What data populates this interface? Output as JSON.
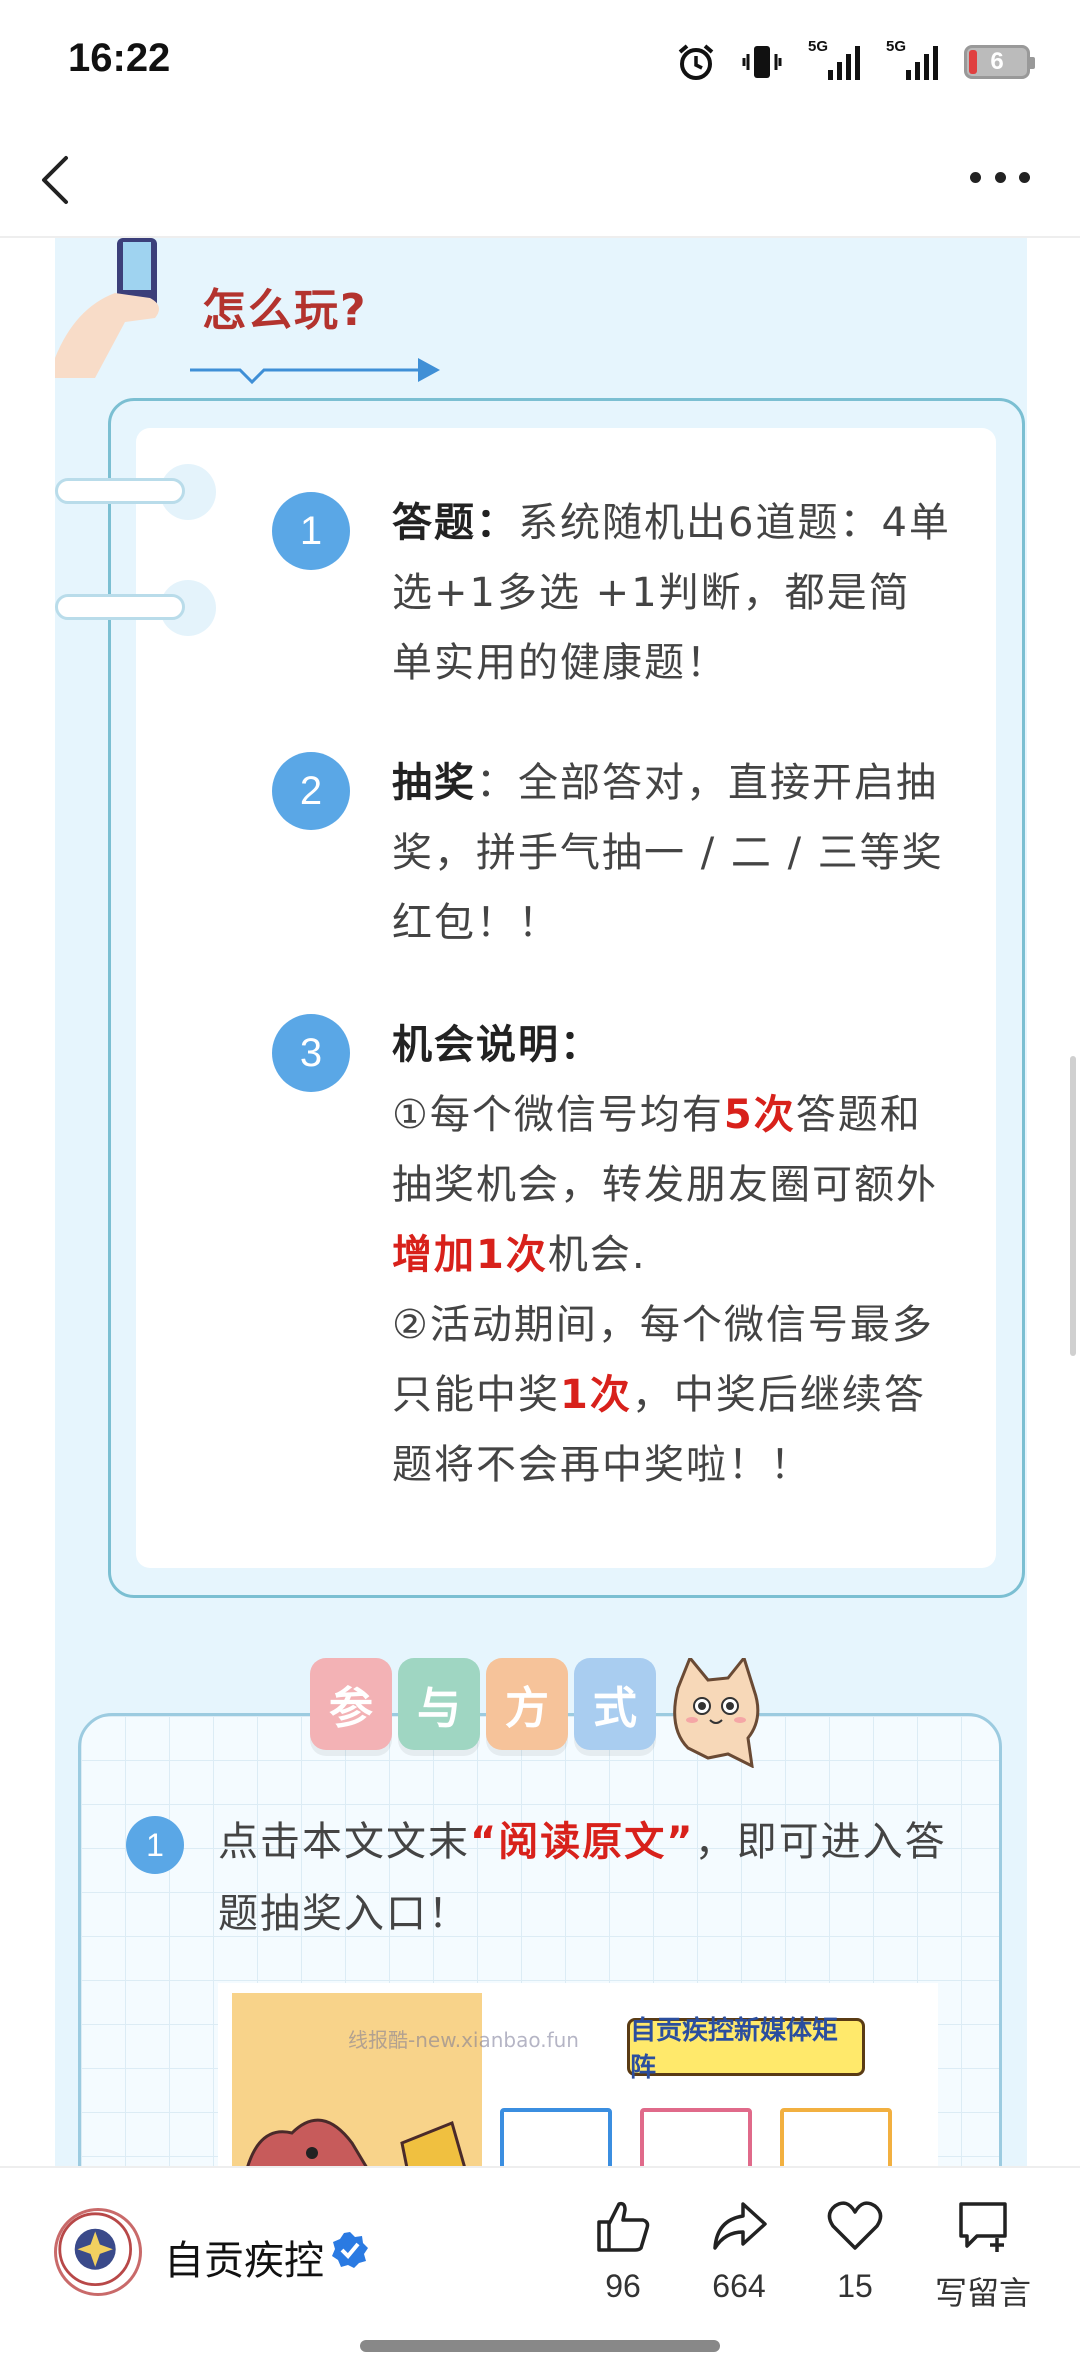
{
  "status_bar": {
    "time": "16:22",
    "network_1": "5G",
    "network_2": "5G",
    "battery": "6"
  },
  "article": {
    "how_title": "怎么玩?",
    "steps": [
      {
        "num": "1",
        "label": "答题：",
        "text": "系统随机出6道题：4单选+1多选 +1判断，都是简单实用的健康题！"
      },
      {
        "num": "2",
        "label": "抽奖",
        "text": "：全部答对，直接开启抽奖，拼手气抽一 / 二 / 三等奖红包！！"
      },
      {
        "num": "3",
        "label": "机会说明：",
        "line1_a": "①每个微信号均有",
        "line1_red": "5次",
        "line1_b": "答题和抽奖机会，转发朋友圈可额外",
        "line1_red2": "增加1次",
        "line1_c": "机会.",
        "line2_a": "②活动期间，每个微信号最多只能中奖",
        "line2_red": "1次",
        "line2_b": "，中奖后继续答题将不会再中奖啦！！"
      }
    ],
    "participate": {
      "tabs": [
        "参",
        "与",
        "方",
        "式"
      ],
      "tab_colors": [
        "#f3b2b5",
        "#9fd6c2",
        "#f6c39a",
        "#a9cdf0"
      ],
      "num": "1",
      "text_a": "点击本文文末",
      "text_red": "“阅读原文”",
      "text_b": "，即可进入答题抽奖入口！",
      "poster_sign": "自贡疾控新媒体矩阵"
    },
    "watermark": "线报酷-new.xianbao.fun"
  },
  "bottom_bar": {
    "account_name": "自贡疾控",
    "likes": "96",
    "shares": "664",
    "favorites": "15",
    "comment_label": "写留言"
  }
}
